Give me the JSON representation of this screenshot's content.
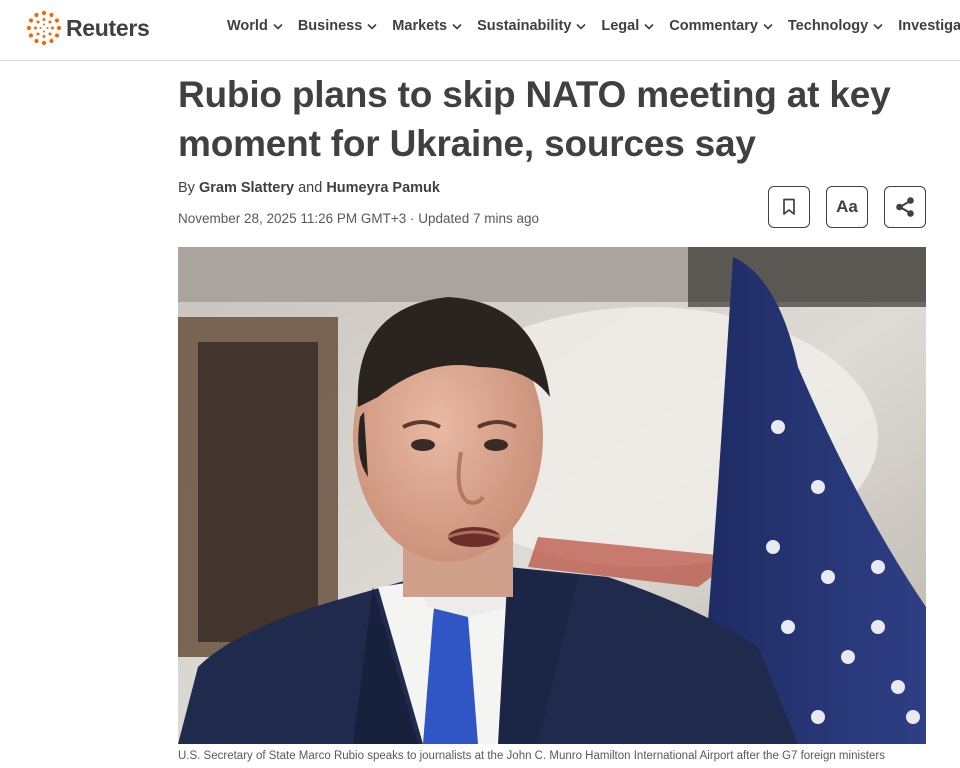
{
  "brand": {
    "name": "Reuters",
    "logo_icon": "reuters-dot-ring-logo",
    "accent_color": "#fa6400"
  },
  "nav": {
    "items": [
      {
        "label": "World"
      },
      {
        "label": "Business"
      },
      {
        "label": "Markets"
      },
      {
        "label": "Sustainability"
      },
      {
        "label": "Legal"
      },
      {
        "label": "Commentary"
      },
      {
        "label": "Technology"
      },
      {
        "label": "Investigations"
      }
    ],
    "dropdown_icon": "chevron-down-icon"
  },
  "article": {
    "headline": "Rubio plans to skip NATO meeting at key moment for Ukraine, sources say",
    "byline": {
      "prefix": "By",
      "author1": "Gram Slattery",
      "conjunction": "and",
      "author2": "Humeyra Pamuk"
    },
    "dateline": "November 28, 2025 11:26 PM GMT+3 · Updated 7 mins ago",
    "tools": {
      "bookmark_icon": "bookmark-icon",
      "text_size_label": "Aa",
      "share_icon": "share-icon"
    },
    "image": {
      "caption": "U.S. Secretary of State Marco Rubio speaks to journalists at the John C. Munro Hamilton International Airport after the G7 foreign ministers"
    }
  }
}
